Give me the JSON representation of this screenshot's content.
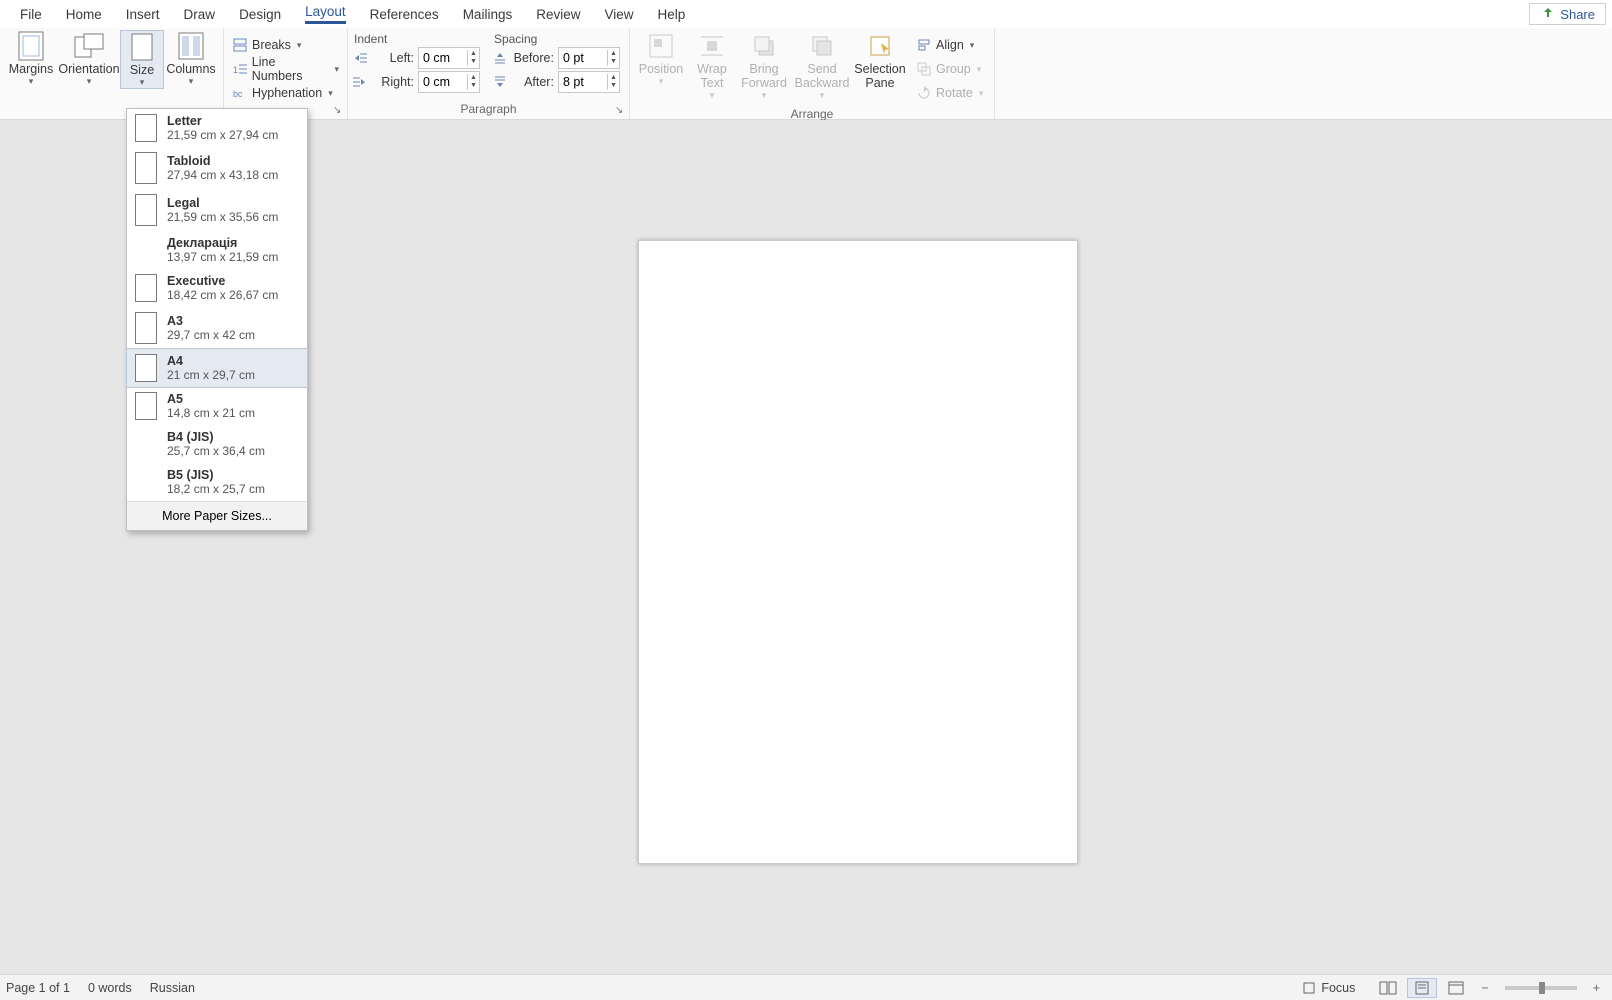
{
  "tabs": {
    "file": "File",
    "home": "Home",
    "insert": "Insert",
    "draw": "Draw",
    "design": "Design",
    "layout": "Layout",
    "references": "References",
    "mailings": "Mailings",
    "review": "Review",
    "view": "View",
    "help": "Help"
  },
  "share": "Share",
  "ribbon": {
    "pagesetup": {
      "margins": "Margins",
      "orientation": "Orientation",
      "size": "Size",
      "columns": "Columns",
      "breaks": "Breaks",
      "linenumbers": "Line Numbers",
      "hyphenation": "Hyphenation"
    },
    "paragraph": {
      "label": "Paragraph",
      "indent_head": "Indent",
      "spacing_head": "Spacing",
      "left_lbl": "Left:",
      "right_lbl": "Right:",
      "before_lbl": "Before:",
      "after_lbl": "After:",
      "left_val": "0 cm",
      "right_val": "0 cm",
      "before_val": "0 pt",
      "after_val": "8 pt"
    },
    "arrange": {
      "label": "Arrange",
      "position": "Position",
      "wraptext": "Wrap Text",
      "bringfwd": "Bring Forward",
      "sendback": "Send Backward",
      "selpane": "Selection Pane",
      "align": "Align",
      "group": "Group",
      "rotate": "Rotate"
    }
  },
  "size_menu": {
    "items": [
      {
        "name": "Letter",
        "dim": "21,59 cm x 27,94 cm"
      },
      {
        "name": "Tabloid",
        "dim": "27,94 cm x 43,18 cm"
      },
      {
        "name": "Legal",
        "dim": "21,59 cm x 35,56 cm"
      },
      {
        "name": "Декларація",
        "dim": "13,97 cm x 21,59 cm"
      },
      {
        "name": "Executive",
        "dim": "18,42 cm x 26,67 cm"
      },
      {
        "name": "A3",
        "dim": "29,7 cm x 42 cm"
      },
      {
        "name": "A4",
        "dim": "21 cm x 29,7 cm"
      },
      {
        "name": "A5",
        "dim": "14,8 cm x 21 cm"
      },
      {
        "name": "B4 (JIS)",
        "dim": "25,7 cm x 36,4 cm"
      },
      {
        "name": "B5 (JIS)",
        "dim": "18,2 cm x 25,7 cm"
      }
    ],
    "more": "More Paper Sizes..."
  },
  "status": {
    "page": "Page 1 of 1",
    "words": "0 words",
    "lang": "Russian",
    "focus": "Focus"
  }
}
